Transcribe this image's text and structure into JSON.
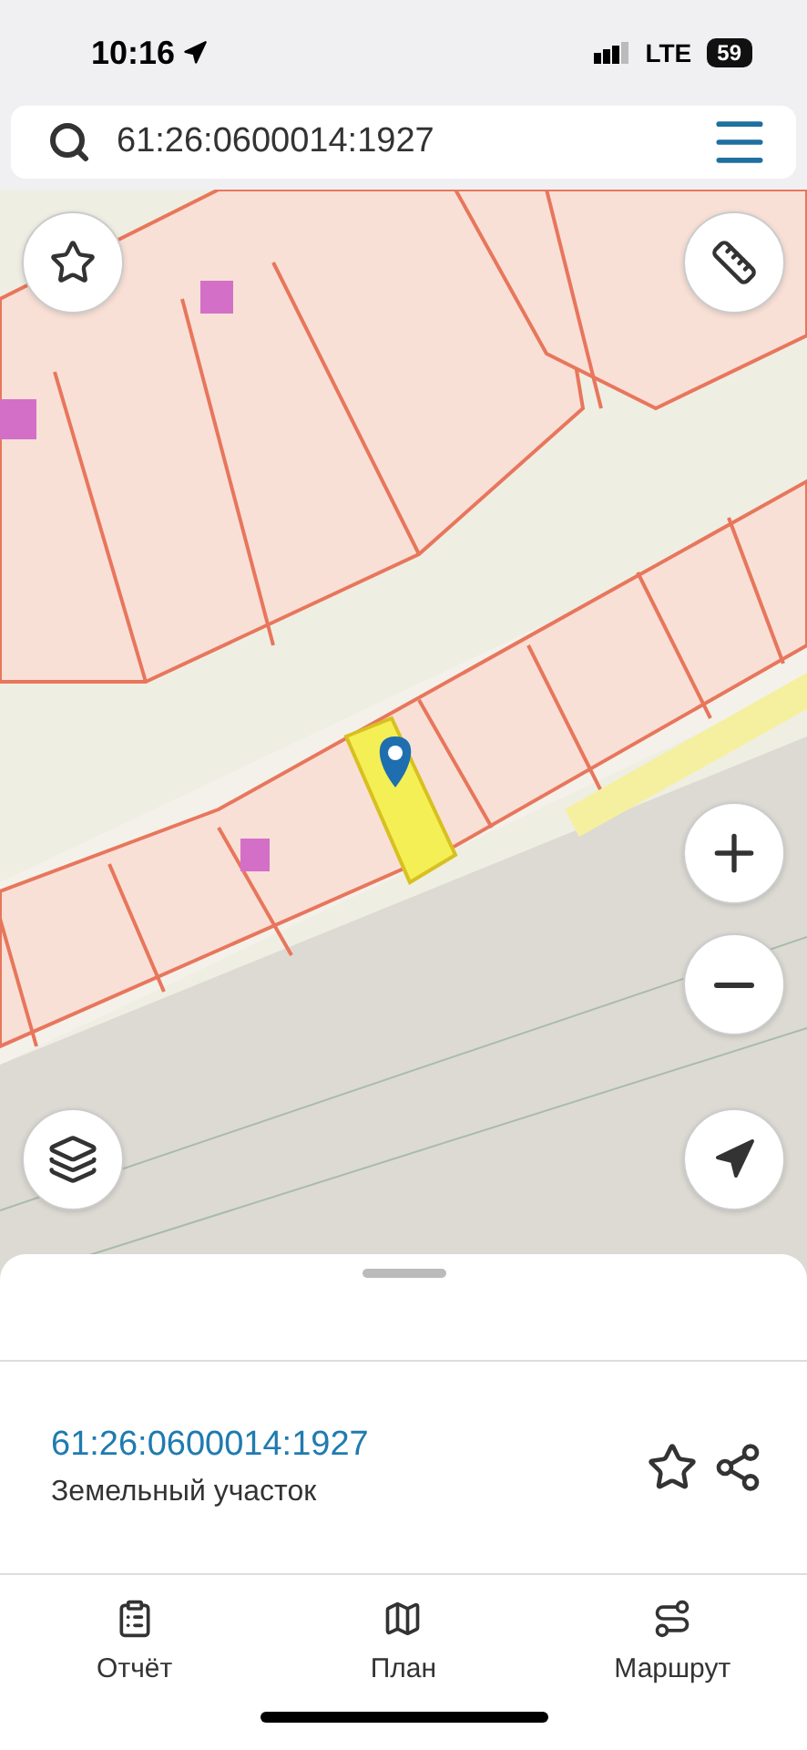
{
  "status_bar": {
    "time": "10:16",
    "network": "LTE",
    "battery": "59"
  },
  "search": {
    "value": "61:26:0600014:1927"
  },
  "result": {
    "title": "61:26:0600014:1927",
    "subtitle": "Земельный участок"
  },
  "tabs": [
    {
      "kind": "report",
      "label": "Отчёт"
    },
    {
      "kind": "plan",
      "label": "План"
    },
    {
      "kind": "route",
      "label": "Маршрут"
    }
  ]
}
